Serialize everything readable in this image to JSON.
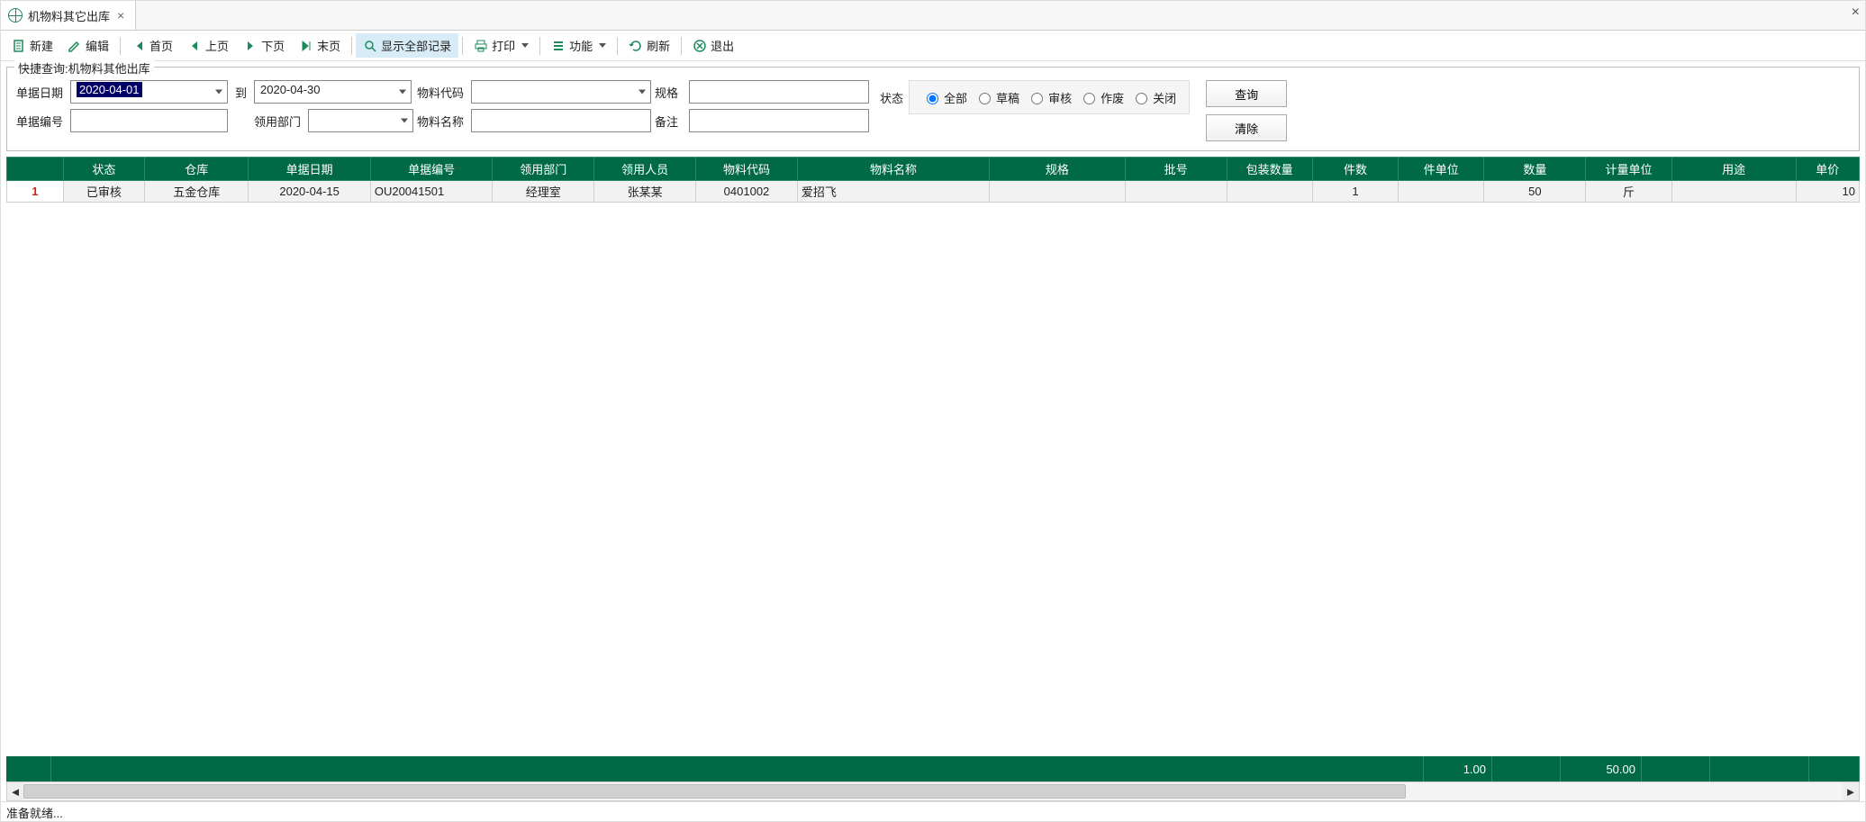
{
  "tab": {
    "title": "机物料其它出库"
  },
  "toolbar": {
    "new_label": "新建",
    "edit_label": "编辑",
    "first_label": "首页",
    "prev_label": "上页",
    "next_label": "下页",
    "last_label": "末页",
    "showall_label": "显示全部记录",
    "print_label": "打印",
    "func_label": "功能",
    "refresh_label": "刷新",
    "exit_label": "退出"
  },
  "search": {
    "legend": "快捷查询:机物料其他出库",
    "date_label": "单据日期",
    "date_from": "2020-04-01",
    "to_label": "到",
    "date_to": "2020-04-30",
    "matcode_label": "物料代码",
    "matcode": "",
    "spec_label": "规格",
    "spec": "",
    "docno_label": "单据编号",
    "docno": "",
    "dept_label": "领用部门",
    "dept": "",
    "matname_label": "物料名称",
    "matname": "",
    "remark_label": "备注",
    "remark": "",
    "status_label": "状态",
    "status_all": "全部",
    "status_draft": "草稿",
    "status_audit": "审核",
    "status_void": "作废",
    "status_close": "关闭",
    "query_btn": "查询",
    "clear_btn": "清除"
  },
  "columns": [
    "",
    "状态",
    "仓库",
    "单据日期",
    "单据编号",
    "领用部门",
    "领用人员",
    "物料代码",
    "物料名称",
    "规格",
    "批号",
    "包装数量",
    "件数",
    "件单位",
    "数量",
    "计量单位",
    "用途",
    "单价"
  ],
  "rows": [
    {
      "num": "1",
      "status": "已审核",
      "warehouse": "五金仓库",
      "date": "2020-04-15",
      "docno": "OU20041501",
      "dept": "经理室",
      "person": "张某某",
      "matcode": "0401002",
      "matname": "爱招飞",
      "spec": "",
      "batch": "",
      "packqty": "",
      "pcs": "1",
      "pcsunit": "",
      "qty": "50",
      "unit": "斤",
      "use": "",
      "price": "10"
    }
  ],
  "summary": {
    "pcs_total": "1.00",
    "qty_total": "50.00"
  },
  "statusbar": "准备就绪..."
}
